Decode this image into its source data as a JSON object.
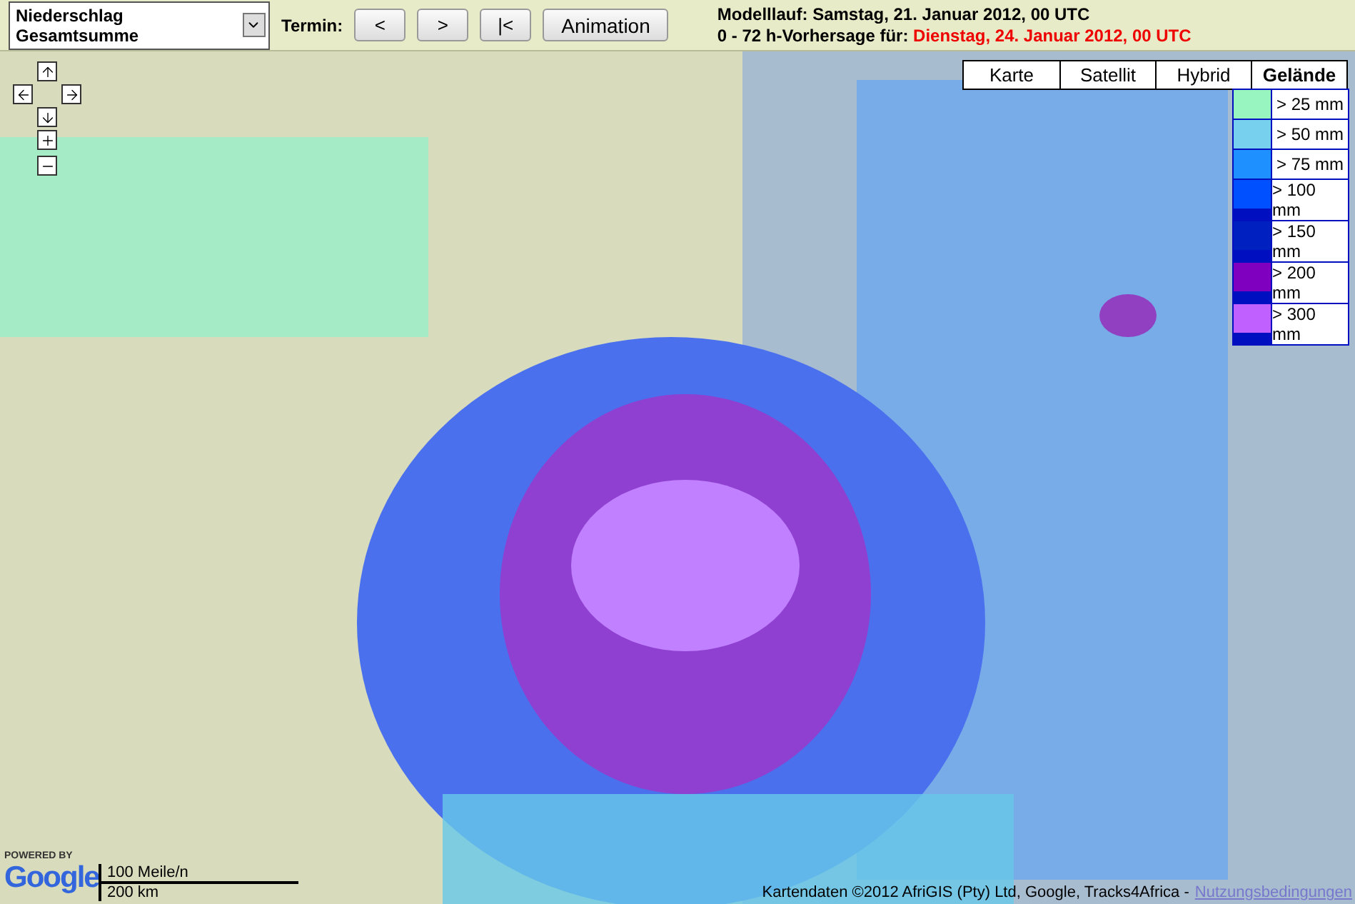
{
  "toolbar": {
    "product_select": {
      "value": "Niederschlag Gesamtsumme"
    },
    "termin_label": "Termin:",
    "buttons": [
      "<",
      ">",
      "|<",
      "Animation"
    ],
    "run_info": {
      "label": "Modelllauf:",
      "value": "Samstag, 21. Januar 2012, 00 UTC"
    },
    "forecast_info": {
      "label": "0 - 72 h-Vorhersage für:",
      "value": "Dienstag, 24. Januar 2012, 00 UTC"
    }
  },
  "map_types": [
    {
      "label": "Karte",
      "selected": false
    },
    {
      "label": "Satellit",
      "selected": false
    },
    {
      "label": "Hybrid",
      "selected": false
    },
    {
      "label": "Gelände",
      "selected": true
    }
  ],
  "legend": [
    {
      "label": "> 25 mm",
      "color": "#99f5bf"
    },
    {
      "label": "> 50 mm",
      "color": "#77d0ee"
    },
    {
      "label": "> 75 mm",
      "color": "#1e90ff"
    },
    {
      "label": "> 100 mm",
      "color": "#0050ff"
    },
    {
      "label": "> 150 mm",
      "color": "#0020c0"
    },
    {
      "label": "> 200 mm",
      "color": "#8000c0"
    },
    {
      "label": "> 300 mm",
      "color": "#c060ff"
    }
  ],
  "branding": {
    "powered_by": "POWERED BY",
    "logo": "Google"
  },
  "scale": {
    "imperial": "100 Meile/n",
    "metric": "200 km"
  },
  "attribution": {
    "text": "Kartendaten ©2012 AfriGIS (Pty) Ltd, Google, Tracks4Africa -",
    "link": "Nutzungsbedingungen"
  }
}
